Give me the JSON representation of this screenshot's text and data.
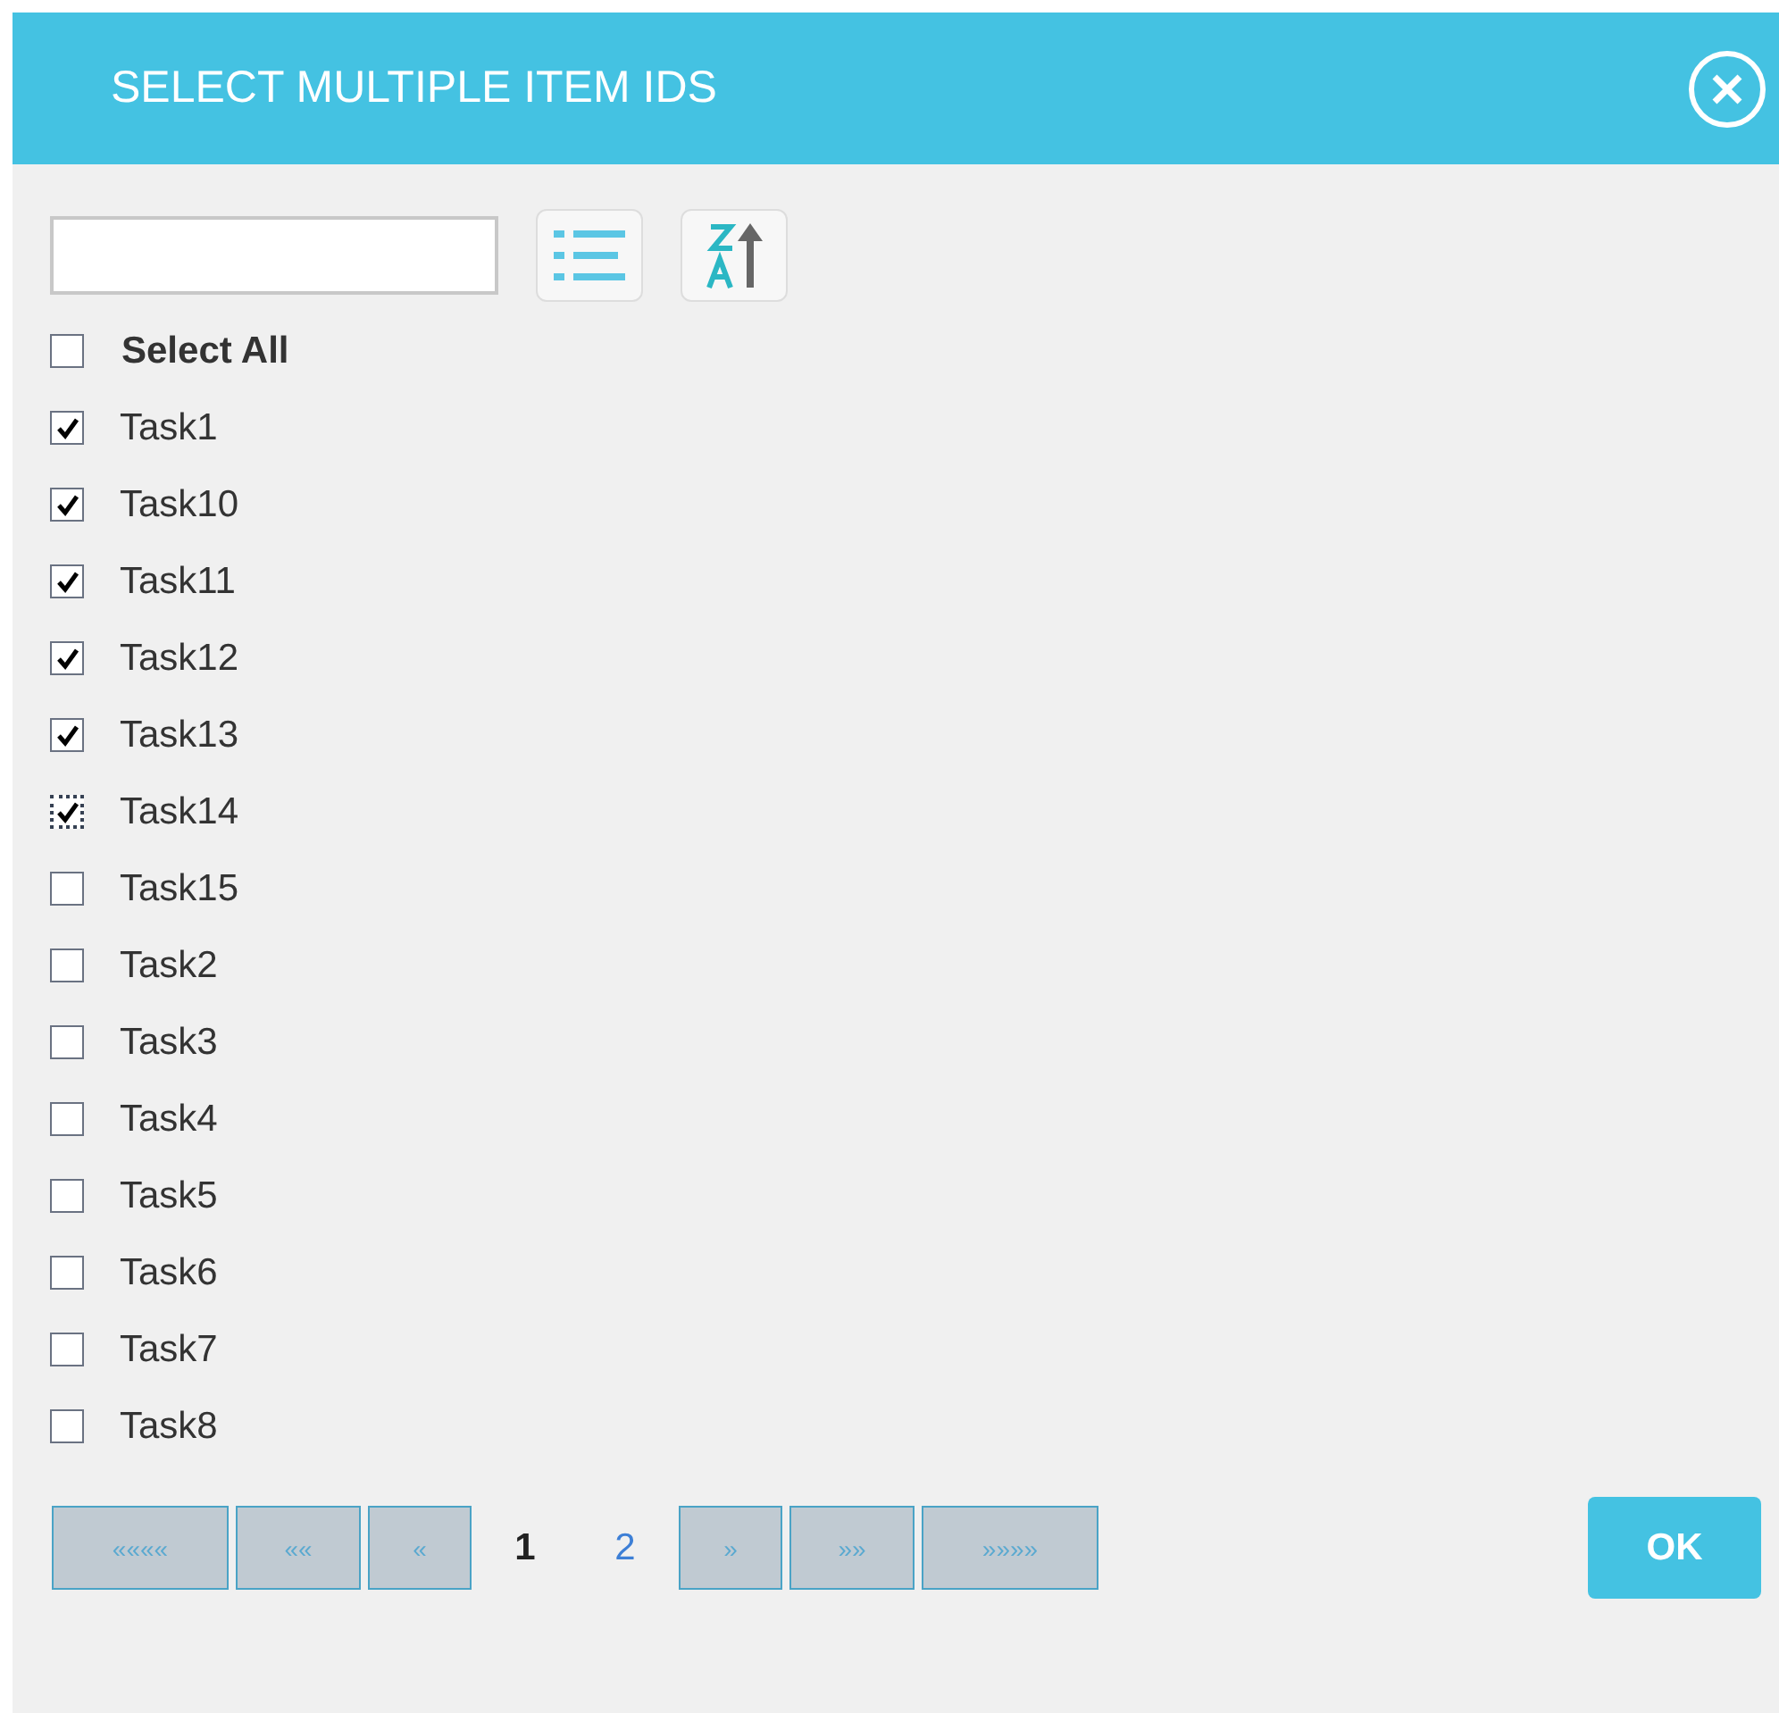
{
  "dialog": {
    "title": "SELECT MULTIPLE ITEM IDS"
  },
  "select_all": {
    "label": "Select All",
    "checked": false
  },
  "items": [
    {
      "label": "Task1",
      "checked": true,
      "focused": false
    },
    {
      "label": "Task10",
      "checked": true,
      "focused": false
    },
    {
      "label": "Task11",
      "checked": true,
      "focused": false
    },
    {
      "label": "Task12",
      "checked": true,
      "focused": false
    },
    {
      "label": "Task13",
      "checked": true,
      "focused": false
    },
    {
      "label": "Task14",
      "checked": true,
      "focused": true
    },
    {
      "label": "Task15",
      "checked": false,
      "focused": false
    },
    {
      "label": "Task2",
      "checked": false,
      "focused": false
    },
    {
      "label": "Task3",
      "checked": false,
      "focused": false
    },
    {
      "label": "Task4",
      "checked": false,
      "focused": false
    },
    {
      "label": "Task5",
      "checked": false,
      "focused": false
    },
    {
      "label": "Task6",
      "checked": false,
      "focused": false
    },
    {
      "label": "Task7",
      "checked": false,
      "focused": false
    },
    {
      "label": "Task8",
      "checked": false,
      "focused": false
    }
  ],
  "pager": {
    "first": "««««",
    "prev_group": "««",
    "prev": "«",
    "pages": [
      {
        "label": "1",
        "selected": true
      },
      {
        "label": "2",
        "selected": false
      }
    ],
    "next": "»",
    "next_group": "»»",
    "last": "»»»»"
  },
  "ok_button": "OK"
}
